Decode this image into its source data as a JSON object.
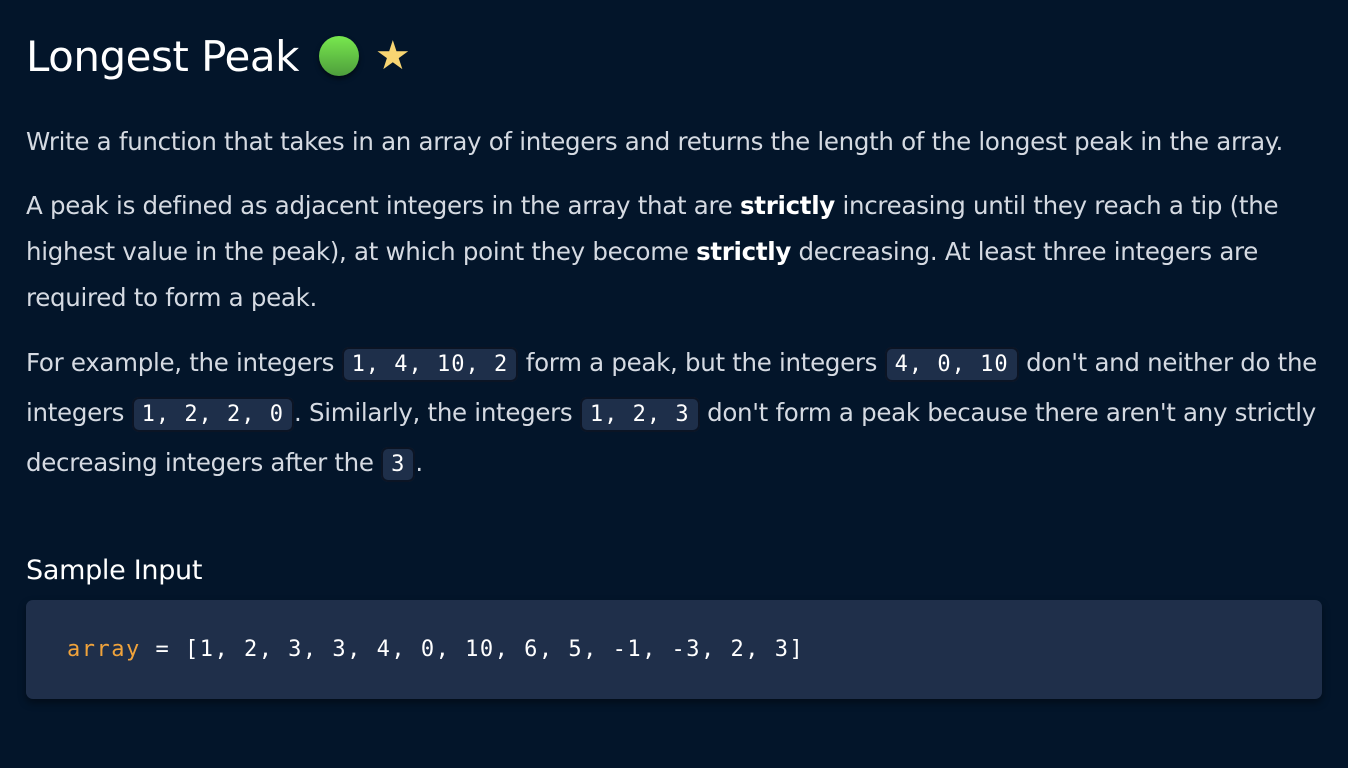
{
  "title": "Longest Peak",
  "difficulty_color": "#5cc642",
  "icons": [
    "difficulty-dot-icon",
    "star-icon"
  ],
  "paragraphs": {
    "p1": "Write a function that takes in an array of integers and returns the length of the longest peak in the array.",
    "p2_a": "A peak is defined as adjacent integers in the array that are ",
    "p2_b": "strictly",
    "p2_c": " increasing until they reach a tip (the highest value in the peak), at which point they become ",
    "p2_d": "strictly",
    "p2_e": " decreasing. At least three integers are required to form a peak.",
    "p3_a": "For example, the integers ",
    "p3_code1": "1, 4, 10, 2",
    "p3_b": " form a peak, but the integers ",
    "p3_code2": "4, 0, 10",
    "p3_c": " don't and neither do the integers ",
    "p3_code3": "1, 2, 2, 0",
    "p3_d": ". Similarly, the integers ",
    "p3_code4": "1, 2, 3",
    "p3_e": " don't form a peak because there aren't any strictly decreasing integers after the ",
    "p3_code5": "3",
    "p3_f": "."
  },
  "sample": {
    "heading": "Sample Input",
    "var": "array",
    "rest": " = [1, 2, 3, 3, 4, 0, 10, 6, 5, -1, -3, 2, 3]"
  }
}
